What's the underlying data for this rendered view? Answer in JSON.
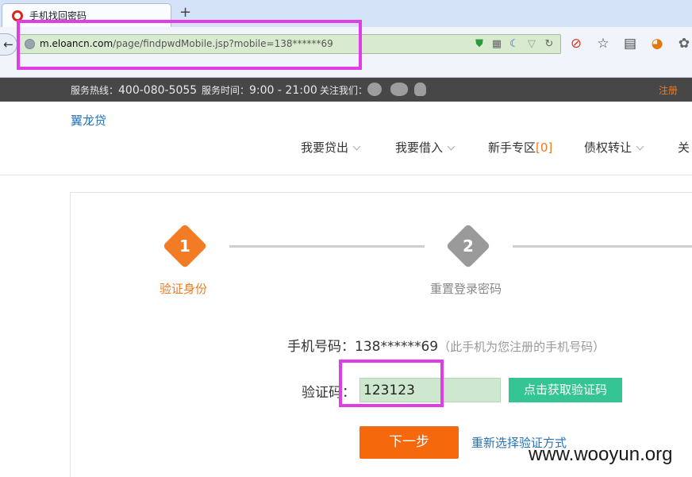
{
  "browser": {
    "tab_title": "手机找回密码",
    "new_tab_label": "+",
    "back_glyph": "←",
    "url_host": "m.eloancn.com",
    "url_path": "/page/findpwdMobile.jsp?mobile=138******69",
    "url_icons": [
      "shield-icon",
      "qr-icon",
      "moon-icon",
      "dropdown-icon",
      "reload-icon"
    ],
    "toolbar_icons": [
      "block-icon",
      "star-icon",
      "reader-icon",
      "firefox-icon",
      "palette-icon"
    ]
  },
  "top_strip": {
    "hotline_label": "服务热线：",
    "hotline_number": "400-080-5055",
    "hours_label": "服务时间：",
    "hours_value": "9:00 - 21:00",
    "follow_label": "关注我们：",
    "register": "注册"
  },
  "header": {
    "logo": "翼龙贷",
    "nav": {
      "lend": "我要贷出",
      "borrow": "我要借入",
      "newbie": "新手专区",
      "newbie_count": "[0]",
      "transfer": "债权转让",
      "about": "关"
    }
  },
  "steps": {
    "step1_number": "1",
    "step1_label": "验证身份",
    "step2_number": "2",
    "step2_label": "重置登录密码"
  },
  "form": {
    "phone_label": "手机号码：",
    "phone_value": "138******69",
    "phone_note": "（此手机为您注册的手机号码）",
    "code_label": "验证码：",
    "code_value": "123123",
    "get_code_button": "点击获取验证码",
    "next_button": "下一步",
    "reselect_link": "重新选择验证方式"
  },
  "watermark": "www.wooyun.org",
  "colors": {
    "accent_orange": "#f37b23",
    "button_green": "#35c594",
    "link_blue": "#2673b8",
    "highlight_magenta": "#e03de6"
  }
}
